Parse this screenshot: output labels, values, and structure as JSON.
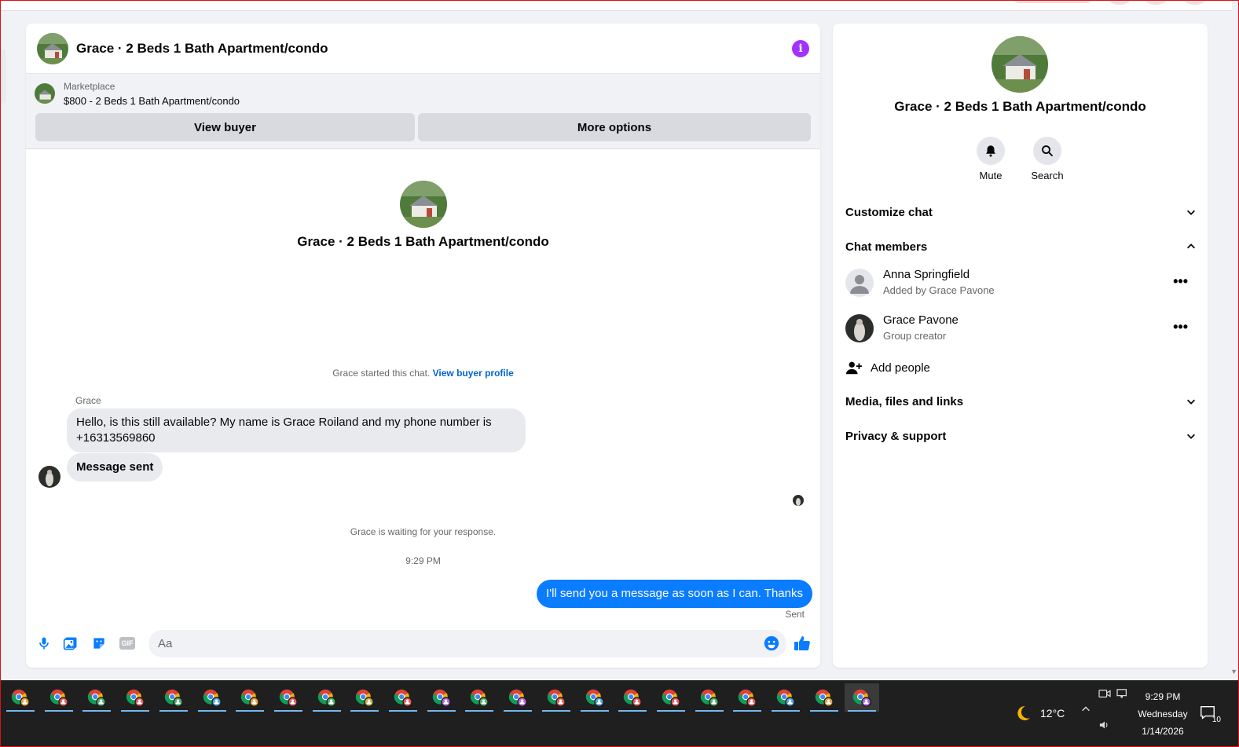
{
  "colors": {
    "accent_blue": "#0a7cff",
    "info_purple": "#a033ff",
    "link_blue": "#0064d1",
    "taskbar_bg": "#1f1f1f"
  },
  "chat": {
    "title": "Grace · 2 Beds 1 Bath Apartment/condo",
    "info_icon": "info-icon",
    "marketplace": {
      "label": "Marketplace",
      "listing": "$800 - 2 Beds 1 Bath Apartment/condo"
    },
    "buttons": {
      "view_buyer": "View buyer",
      "more_options": "More options"
    },
    "intro_title": "Grace · 2 Beds 1 Bath Apartment/condo",
    "started_text": "Grace started this chat.",
    "started_link": "View buyer profile",
    "sender_name": "Grace",
    "messages_in": [
      {
        "line1": "Hello, is this still available? My name is Grace Roiland and my phone number is",
        "line2": "+16313569860"
      },
      {
        "text": "Message sent"
      }
    ],
    "waiting_text": "Grace is waiting for your response.",
    "timestamp": "9:29 PM",
    "message_out": "I'll send you a message as soon as I can. Thanks",
    "sent_status": "Sent",
    "composer": {
      "placeholder": "Aa",
      "icons": [
        "microphone-icon",
        "photo-icon",
        "sticker-icon",
        "gif-icon",
        "emoji-icon",
        "like-icon"
      ],
      "gif_label": "GIF"
    }
  },
  "info_panel": {
    "title": "Grace · 2 Beds 1 Bath Apartment/condo",
    "actions": [
      {
        "label": "Mute",
        "icon": "bell-icon"
      },
      {
        "label": "Search",
        "icon": "search-icon"
      }
    ],
    "sections": {
      "customize": "Customize chat",
      "members": "Chat members",
      "media": "Media, files and links",
      "privacy": "Privacy & support"
    },
    "members": [
      {
        "name": "Anna Springfield",
        "subtitle": "Added by Grace Pavone"
      },
      {
        "name": "Grace Pavone",
        "subtitle": "Group creator"
      }
    ],
    "member_menu": "•••",
    "add_people": "Add people"
  },
  "taskbar": {
    "app_count": 23,
    "weather": "12°C",
    "weather_icon": "moon-icon",
    "time": "9:29 PM",
    "day": "Wednesday",
    "date": "1/14/2026",
    "notification_count": "10"
  }
}
